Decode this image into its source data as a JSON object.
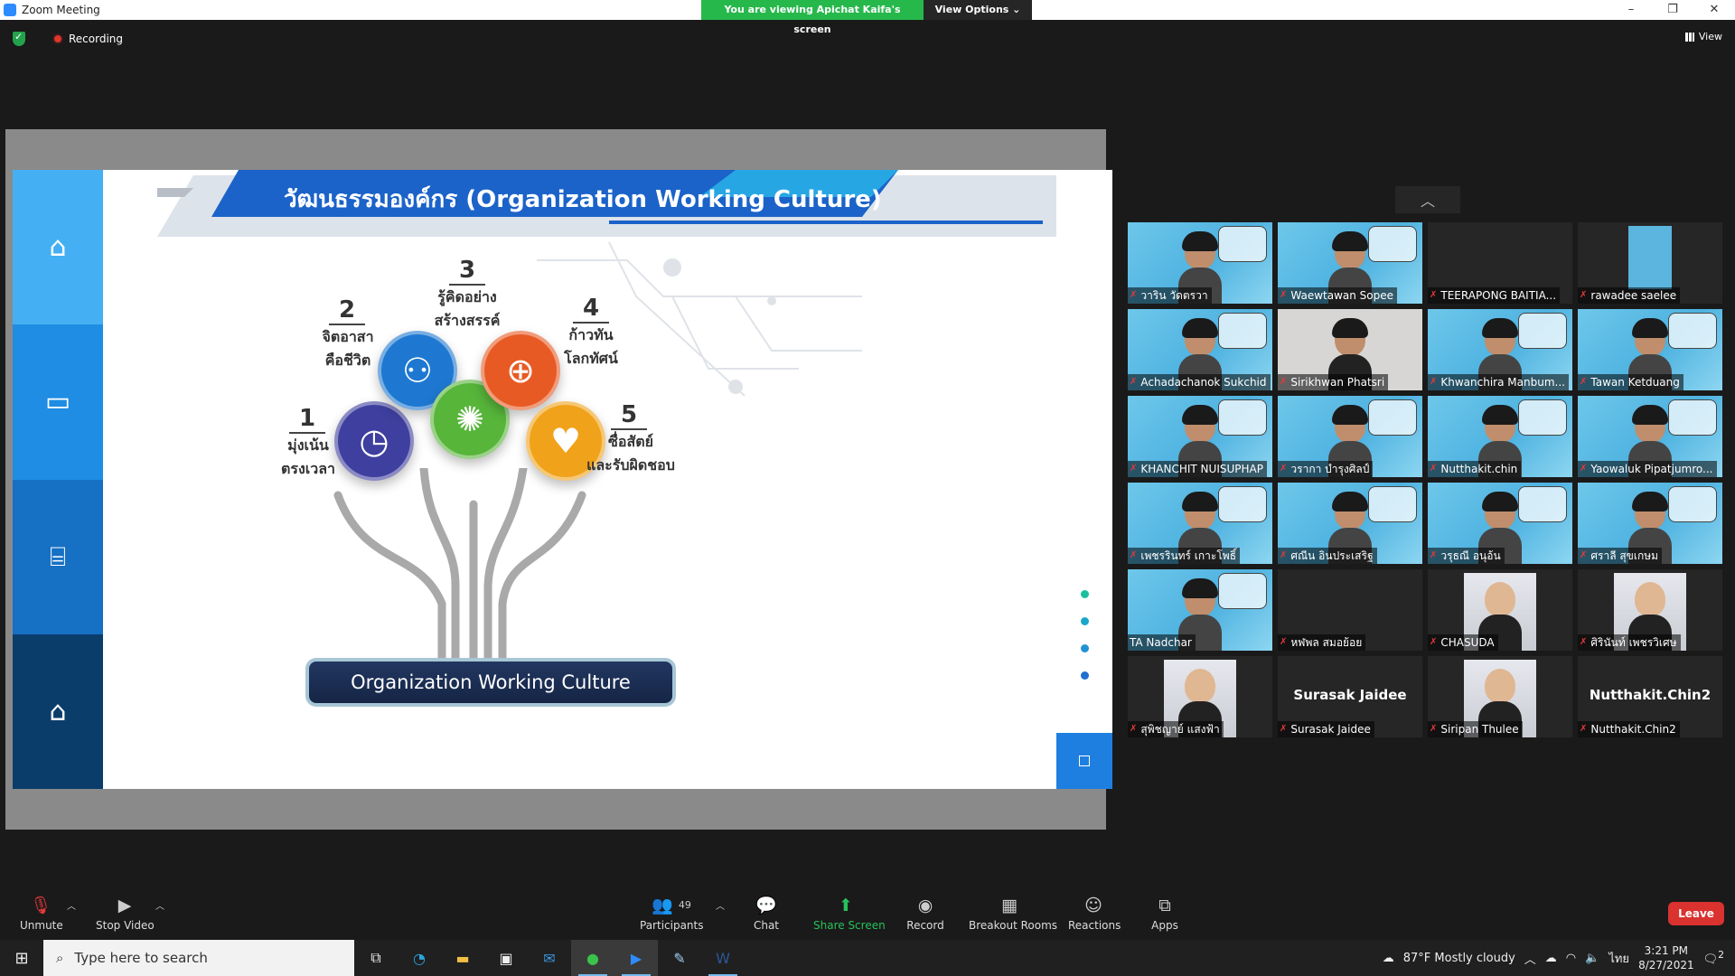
{
  "window": {
    "title": "Zoom Meeting",
    "banner_text": "You are viewing Apichat Kaifa's screen",
    "view_options_label": "View Options ⌄",
    "minimize": "–",
    "maximize": "❐",
    "close": "✕"
  },
  "status": {
    "recording_label": "Recording",
    "view_label": "View"
  },
  "slide": {
    "title": "วัฒนธรรมองค์กร (Organization Working Culture)",
    "footer_label": "Organization Working Culture",
    "sidebar_colors": [
      "#44b0f3",
      "#1e8de3",
      "#1670c3",
      "#0b3d6b"
    ],
    "items": [
      {
        "num": "1",
        "line1": "มุ่งเน้น",
        "line2": "ตรงเวลา",
        "icon": "clock-icon",
        "color": "#3e3f9e"
      },
      {
        "num": "2",
        "line1": "จิตอาสา",
        "line2": "คือชีวิต",
        "icon": "people-icon",
        "color": "#1e78d1"
      },
      {
        "num": "3",
        "line1": "รู้คิดอย่าง",
        "line2": "สร้างสรรค์",
        "icon": "lightbulb-icon",
        "color": "#57b53a"
      },
      {
        "num": "4",
        "line1": "ก้าวทัน",
        "line2": "โลกทัศน์",
        "icon": "globe-icon",
        "color": "#e85a24"
      },
      {
        "num": "5",
        "line1": "ซื่อสัตย์",
        "line2": "และรับผิดชอบ",
        "icon": "heart-hand-icon",
        "color": "#f0a21a"
      }
    ],
    "dot_colors": [
      "#1bbf9e",
      "#1aa7c7",
      "#2192d3",
      "#1f6fd0"
    ]
  },
  "participants": [
    {
      "name": "วาริน วัดตรวา",
      "type": "video"
    },
    {
      "name": "Waewtawan Sopee",
      "type": "video"
    },
    {
      "name": "TEERAPONG BAITIA...",
      "type": "off"
    },
    {
      "name": "rawadee saelee",
      "type": "video-small"
    },
    {
      "name": "Achadachanok Sukchid",
      "type": "video"
    },
    {
      "name": "Sirikhwan Phatsri",
      "type": "plain"
    },
    {
      "name": "Khwanchira Manbum...",
      "type": "video"
    },
    {
      "name": "Tawan Ketduang",
      "type": "video"
    },
    {
      "name": "KHANCHIT NUISUPHAP",
      "type": "video"
    },
    {
      "name": "วรากา บำรุงศิลป์",
      "type": "video"
    },
    {
      "name": "Nutthakit.chin",
      "type": "video"
    },
    {
      "name": "Yaowaluk Pipatjumro...",
      "type": "video"
    },
    {
      "name": "เพชรรินทร์ เกาะโพธิ์",
      "type": "video"
    },
    {
      "name": "ศณีน อินประเสริฐ",
      "type": "video"
    },
    {
      "name": "วรุธณี อนุอ้น",
      "type": "video"
    },
    {
      "name": "ศราลี สุขเกษม",
      "type": "video"
    },
    {
      "name": "TA Nadchar",
      "type": "video-nomic"
    },
    {
      "name": "หฬพล สมอย้อย",
      "type": "off"
    },
    {
      "name": "CHASUDA",
      "type": "photo"
    },
    {
      "name": "ศิรินันท์ เพชรวิเศษ",
      "type": "photo"
    },
    {
      "name": "สุพิชญาย์ แสงฟ้า",
      "type": "photo"
    },
    {
      "name": "Surasak Jaidee",
      "type": "namecard",
      "card": "Surasak Jaidee"
    },
    {
      "name": "Siripan Thulee",
      "type": "photo"
    },
    {
      "name": "Nutthakit.Chin2",
      "type": "namecard",
      "card": "Nutthakit.Chin2"
    }
  ],
  "toolbar": {
    "unmute": "Unmute",
    "stop_video": "Stop Video",
    "participants": "Participants",
    "participant_count": "49",
    "chat": "Chat",
    "share_screen": "Share Screen",
    "record": "Record",
    "breakout_rooms": "Breakout Rooms",
    "reactions": "Reactions",
    "apps": "Apps",
    "leave": "Leave"
  },
  "taskbar": {
    "search_placeholder": "Type here to search",
    "weather": "87°F  Mostly cloudy",
    "language": "ไทย",
    "time": "3:21 PM",
    "date": "8/27/2021",
    "notifications": "2"
  }
}
